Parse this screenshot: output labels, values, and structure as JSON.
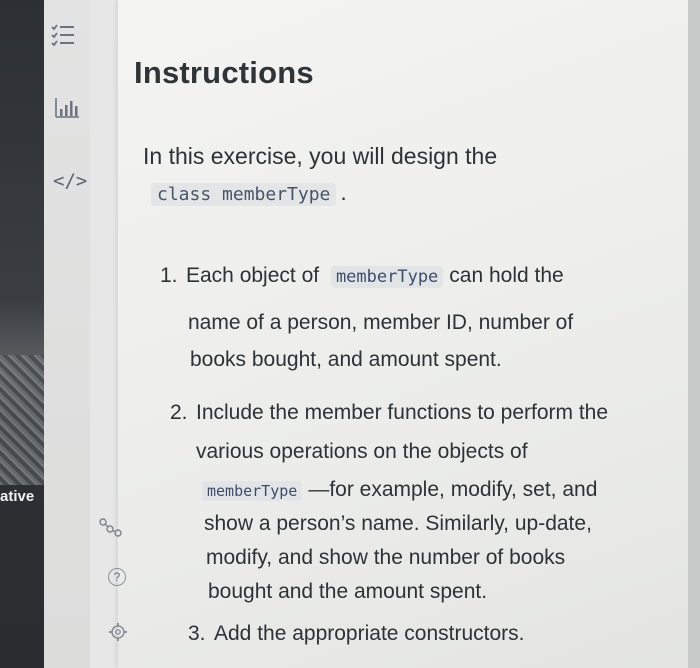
{
  "left_fragment_text": "ative",
  "sidebar": {
    "icons": [
      {
        "name": "checklist-icon"
      },
      {
        "name": "bar-chart-icon"
      },
      {
        "name": "code-icon",
        "glyph": "</>"
      }
    ],
    "small_icons": [
      {
        "name": "share-icon"
      },
      {
        "name": "help-icon"
      },
      {
        "name": "settings-icon"
      }
    ]
  },
  "main": {
    "title": "Instructions",
    "intro_prefix": "In this exercise, you will design the",
    "intro_code": "class memberType",
    "intro_suffix": ".",
    "items": [
      {
        "number": "1.",
        "line1_prefix": "Each object of",
        "line1_code": "memberType",
        "line1_suffix": "can hold the",
        "line2": "name of a person, member ID, number of",
        "line3": "books bought, and amount spent."
      },
      {
        "number": "2.",
        "line1": "Include the member functions to perform the",
        "line2": "various operations on the objects of",
        "line3_code": "memberType",
        "line3_suffix": "—for example, modify, set, and",
        "line4": "show a person’s name. Similarly, up-date,",
        "line5": "modify, and show the number of books",
        "line6": "bought and the amount spent."
      },
      {
        "number": "3.",
        "line1": "Add the appropriate constructors."
      }
    ]
  },
  "colors": {
    "panel_bg": "#f0f1ef",
    "text": "#2d3236",
    "code_text": "#3e4c69",
    "icon": "#6b7280"
  }
}
